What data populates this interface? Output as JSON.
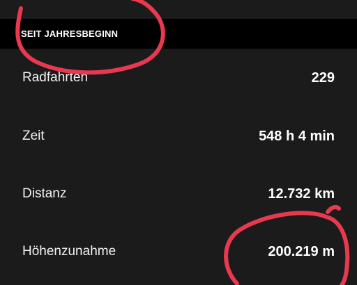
{
  "section": {
    "title": "SEIT JAHRESBEGINN"
  },
  "stats": [
    {
      "label": "Radfahrten",
      "value": "229"
    },
    {
      "label": "Zeit",
      "value": "548 h 4 min"
    },
    {
      "label": "Distanz",
      "value": "12.732 km"
    },
    {
      "label": "Höhenzunahme",
      "value": "200.219 m"
    }
  ],
  "colors": {
    "background": "#1b1b1b",
    "header_background": "#000000",
    "annotation": "#e8394f"
  }
}
